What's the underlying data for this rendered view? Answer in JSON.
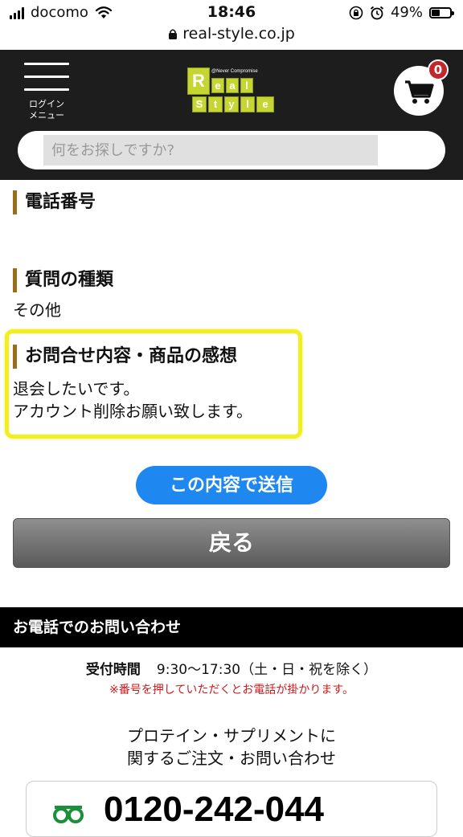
{
  "status_bar": {
    "carrier": "docomo",
    "time": "18:46",
    "battery": "49%",
    "battery_level": 0.49
  },
  "url_bar": {
    "domain": "real-style.co.jp"
  },
  "header": {
    "menu_label": "ログイン\nメニュー",
    "logo": {
      "tagline": "@Never Compromise",
      "letters_row1": [
        "R",
        "e",
        "a",
        "l"
      ],
      "letters_row2": [
        "S",
        "t",
        "y",
        "l",
        "e"
      ]
    },
    "cart_count": "0",
    "search_placeholder": "何をお探しですか?"
  },
  "form": {
    "phone_heading": "電話番号",
    "question_type_heading": "質問の種類",
    "question_type_value": "その他",
    "inquiry_heading": "お問合せ内容・商品の感想",
    "inquiry_line1": "退会したいです。",
    "inquiry_line2": "アカウント削除お願い致します。",
    "submit_label": "この内容で送信",
    "back_label": "戻る"
  },
  "contact": {
    "section_title": "お電話でのお問い合わせ",
    "hours_label": "受付時間",
    "hours_value": "9:30〜17:30（土・日・祝を除く）",
    "notice": "※番号を押していただくとお電話が掛かります。",
    "topic_line1": "プロテイン・サプリメントに",
    "topic_line2": "関するご注文・お問い合わせ",
    "phone_number": "0120-242-044"
  },
  "colors": {
    "header_bg": "#1d1d1d",
    "logo_green": "#c5d531",
    "heading_bar": "#9a6d1b",
    "submit_blue": "#1e88f0",
    "highlight_yellow": "#f2ef1c",
    "notice_red": "#d0191b",
    "badge_red": "#c0282d",
    "freedial_green": "#1a8f3c"
  }
}
